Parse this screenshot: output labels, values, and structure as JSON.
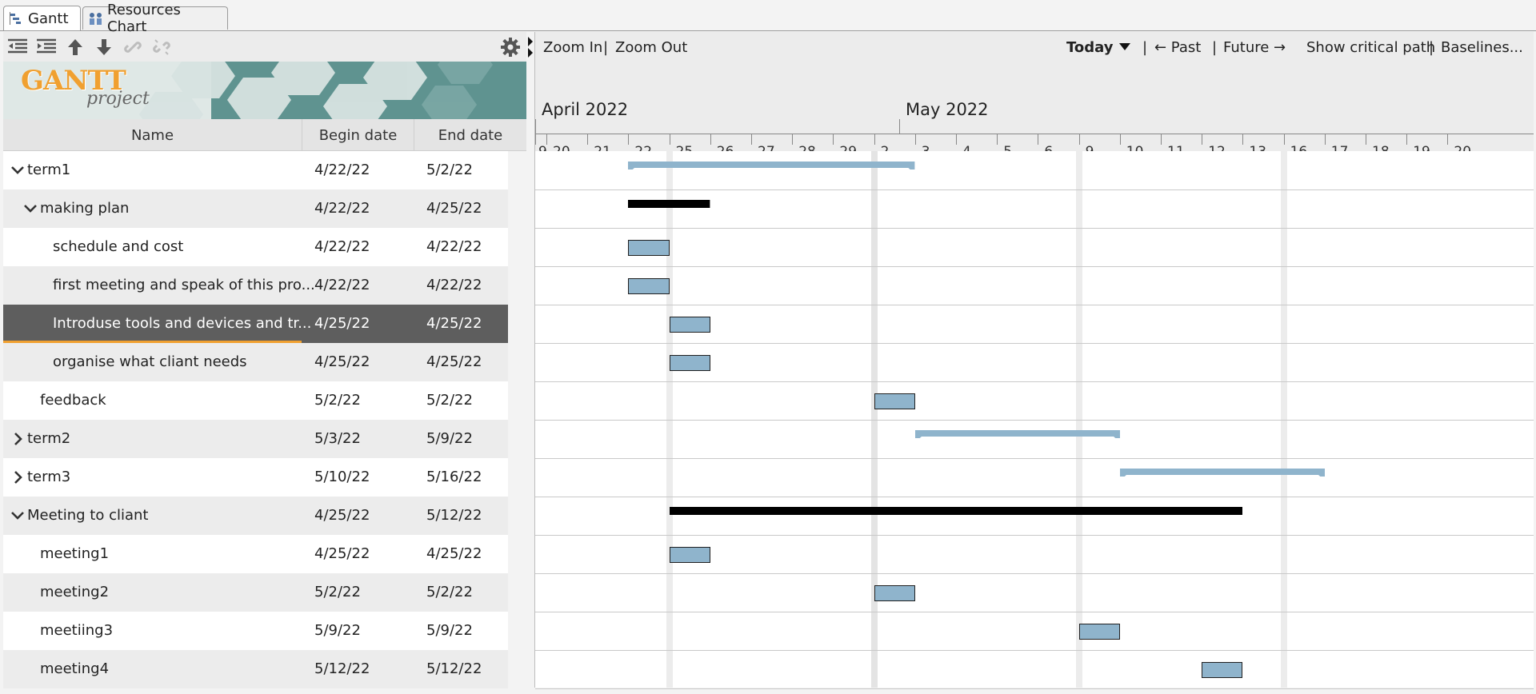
{
  "tabs": [
    {
      "label": "Gantt",
      "icon": "gantt-icon",
      "active": true
    },
    {
      "label": "Resources Chart",
      "icon": "resources-icon",
      "active": false
    }
  ],
  "left_toolbar": {
    "buttons": [
      "outdent-icon",
      "indent-icon",
      "move-up-icon",
      "move-down-icon",
      "link-icon",
      "unlink-icon"
    ],
    "settings": "gear-icon"
  },
  "banner": {
    "logo_text": "GANTT",
    "logo_sub": "project"
  },
  "columns": {
    "name": "Name",
    "begin": "Begin date",
    "end": "End date"
  },
  "tasks": [
    {
      "name": "term1",
      "begin": "4/22/22",
      "end": "5/2/22",
      "level": 0,
      "toggle": "expanded"
    },
    {
      "name": "making plan",
      "begin": "4/22/22",
      "end": "4/25/22",
      "level": 1,
      "toggle": "expanded"
    },
    {
      "name": "schedule and cost",
      "begin": "4/22/22",
      "end": "4/22/22",
      "level": 2,
      "toggle": "none"
    },
    {
      "name": "first meeting and speak of this pro...",
      "begin": "4/22/22",
      "end": "4/22/22",
      "level": 2,
      "toggle": "none"
    },
    {
      "name": "Introduse tools and devices and tr...",
      "begin": "4/25/22",
      "end": "4/25/22",
      "level": 2,
      "toggle": "none",
      "selected": true
    },
    {
      "name": "organise what cliant needs",
      "begin": "4/25/22",
      "end": "4/25/22",
      "level": 2,
      "toggle": "none"
    },
    {
      "name": "feedback",
      "begin": "5/2/22",
      "end": "5/2/22",
      "level": 1,
      "toggle": "none"
    },
    {
      "name": "term2",
      "begin": "5/3/22",
      "end": "5/9/22",
      "level": 0,
      "toggle": "collapsed"
    },
    {
      "name": "term3",
      "begin": "5/10/22",
      "end": "5/16/22",
      "level": 0,
      "toggle": "collapsed"
    },
    {
      "name": "Meeting to cliant",
      "begin": "4/25/22",
      "end": "5/12/22",
      "level": 0,
      "toggle": "expanded"
    },
    {
      "name": "meeting1",
      "begin": "4/25/22",
      "end": "4/25/22",
      "level": 1,
      "toggle": "none"
    },
    {
      "name": "meeting2",
      "begin": "5/2/22",
      "end": "5/2/22",
      "level": 1,
      "toggle": "none"
    },
    {
      "name": "meetiing3",
      "begin": "5/9/22",
      "end": "5/9/22",
      "level": 1,
      "toggle": "none"
    },
    {
      "name": "meeting4",
      "begin": "5/12/22",
      "end": "5/12/22",
      "level": 1,
      "toggle": "none"
    }
  ],
  "chart_toolbar": {
    "zoom_in": "Zoom In",
    "sep1": "|",
    "zoom_out": "Zoom Out",
    "today": "Today",
    "sep2": "|",
    "past": "← Past",
    "sep3": "|",
    "future": "Future →",
    "critical_path": "Show critical path",
    "sep4": "|",
    "baselines": "Baselines..."
  },
  "timeline": {
    "months": [
      "April 2022",
      "May 2022"
    ],
    "day_labels": [
      "9",
      "20",
      "21",
      "22",
      "25",
      "26",
      "27",
      "28",
      "29",
      "2",
      "3",
      "4",
      "5",
      "6",
      "9",
      "10",
      "11",
      "12",
      "13",
      "16",
      "17",
      "18",
      "19",
      "20"
    ]
  },
  "chart_bars": [
    {
      "row": 0,
      "start": "4/22/22",
      "end": "5/2/22",
      "kind": "summary-collapsed"
    },
    {
      "row": 1,
      "start": "4/22/22",
      "end": "4/25/22",
      "kind": "summary"
    },
    {
      "row": 2,
      "start": "4/22/22",
      "end": "4/22/22",
      "kind": "task"
    },
    {
      "row": 3,
      "start": "4/22/22",
      "end": "4/22/22",
      "kind": "task"
    },
    {
      "row": 4,
      "start": "4/25/22",
      "end": "4/25/22",
      "kind": "task"
    },
    {
      "row": 5,
      "start": "4/25/22",
      "end": "4/25/22",
      "kind": "task"
    },
    {
      "row": 6,
      "start": "5/2/22",
      "end": "5/2/22",
      "kind": "task"
    },
    {
      "row": 7,
      "start": "5/3/22",
      "end": "5/9/22",
      "kind": "summary-collapsed"
    },
    {
      "row": 8,
      "start": "5/10/22",
      "end": "5/16/22",
      "kind": "summary-collapsed"
    },
    {
      "row": 9,
      "start": "4/25/22",
      "end": "5/12/22",
      "kind": "summary"
    },
    {
      "row": 10,
      "start": "4/25/22",
      "end": "4/25/22",
      "kind": "task"
    },
    {
      "row": 11,
      "start": "5/2/22",
      "end": "5/2/22",
      "kind": "task"
    },
    {
      "row": 12,
      "start": "5/9/22",
      "end": "5/9/22",
      "kind": "task"
    },
    {
      "row": 13,
      "start": "5/12/22",
      "end": "5/12/22",
      "kind": "task"
    }
  ],
  "colors": {
    "task_bar": "#8fb4cc",
    "summary_bar": "#000000",
    "collapsed_summary": "#8fb4cc",
    "selected_row": "#5e5e5e",
    "accent": "#f0a030"
  }
}
